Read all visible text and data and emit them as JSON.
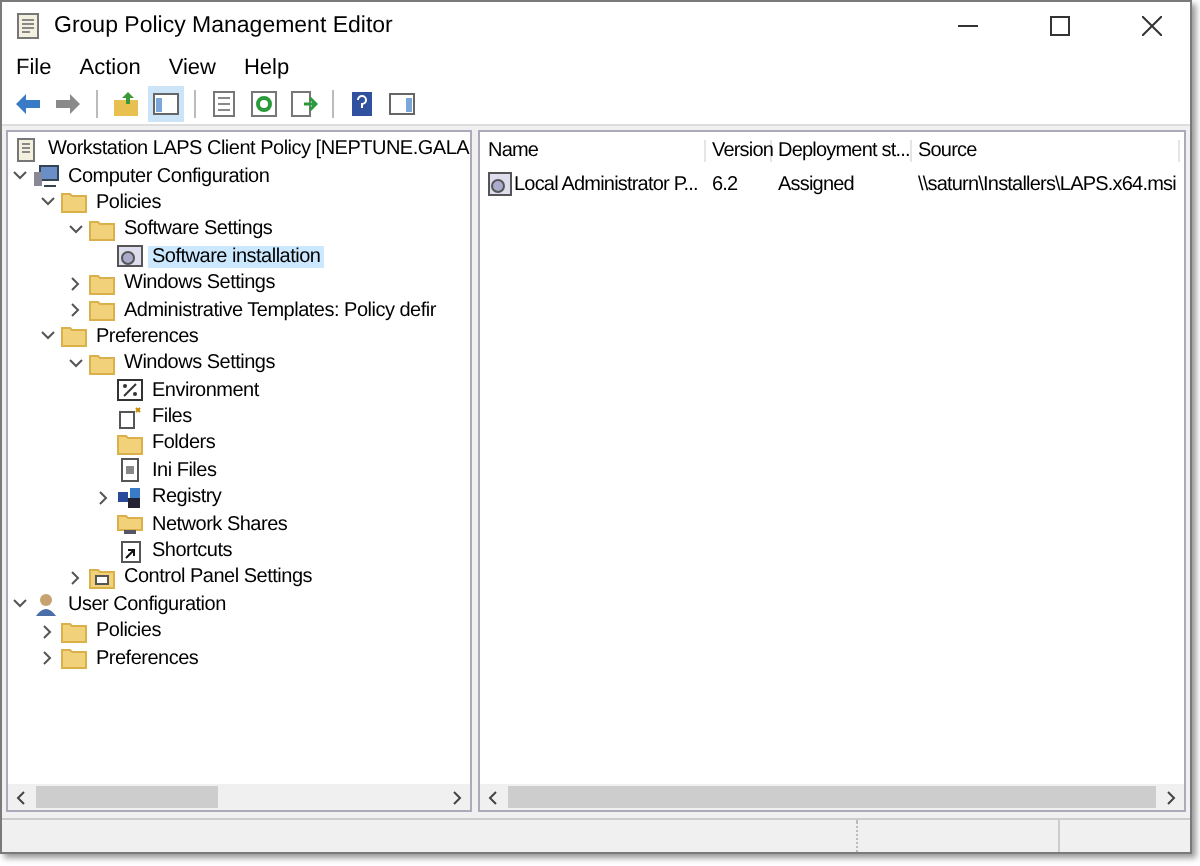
{
  "window": {
    "title": "Group Policy Management Editor"
  },
  "menu": [
    "File",
    "Action",
    "View",
    "Help"
  ],
  "toolbar": [
    {
      "kind": "back",
      "pressed": false
    },
    {
      "kind": "forward",
      "pressed": false
    },
    {
      "kind": "sep"
    },
    {
      "kind": "up",
      "pressed": false
    },
    {
      "kind": "tree",
      "pressed": true
    },
    {
      "kind": "sep"
    },
    {
      "kind": "properties",
      "pressed": false
    },
    {
      "kind": "refresh",
      "pressed": false
    },
    {
      "kind": "export",
      "pressed": false
    },
    {
      "kind": "sep"
    },
    {
      "kind": "help",
      "pressed": false
    },
    {
      "kind": "pane",
      "pressed": false
    }
  ],
  "tree": [
    {
      "label": "Workstation LAPS Client Policy [NEPTUNE.GALA",
      "kind": "policy",
      "selected": false
    },
    {
      "label": "Computer Configuration",
      "kind": "computer",
      "expanded": true,
      "selected": false,
      "children": [
        {
          "label": "Policies",
          "kind": "folder",
          "expanded": true,
          "selected": false,
          "children": [
            {
              "label": "Software Settings",
              "kind": "folder",
              "expanded": true,
              "selected": false,
              "children": [
                {
                  "label": "Software installation",
                  "kind": "install",
                  "selected": true
                }
              ]
            },
            {
              "label": "Windows Settings",
              "kind": "folder",
              "expanded": false,
              "selected": false
            },
            {
              "label": "Administrative Templates: Policy defir",
              "kind": "folder",
              "expanded": false,
              "selected": false
            }
          ]
        },
        {
          "label": "Preferences",
          "kind": "folder",
          "expanded": true,
          "selected": false,
          "children": [
            {
              "label": "Windows Settings",
              "kind": "folder",
              "expanded": true,
              "selected": false,
              "children": [
                {
                  "label": "Environment",
                  "kind": "env",
                  "selected": false
                },
                {
                  "label": "Files",
                  "kind": "files",
                  "selected": false
                },
                {
                  "label": "Folders",
                  "kind": "folder",
                  "selected": false
                },
                {
                  "label": "Ini Files",
                  "kind": "ini",
                  "selected": false
                },
                {
                  "label": "Registry",
                  "kind": "registry",
                  "expanded": false,
                  "selected": false
                },
                {
                  "label": "Network Shares",
                  "kind": "share",
                  "selected": false
                },
                {
                  "label": "Shortcuts",
                  "kind": "shortcut",
                  "selected": false
                }
              ]
            },
            {
              "label": "Control Panel Settings",
              "kind": "panel",
              "expanded": false,
              "selected": false
            }
          ]
        }
      ]
    },
    {
      "label": "User Configuration",
      "kind": "user",
      "expanded": true,
      "selected": false,
      "children": [
        {
          "label": "Policies",
          "kind": "folder",
          "expanded": false,
          "selected": false
        },
        {
          "label": "Preferences",
          "kind": "folder",
          "expanded": false,
          "selected": false
        }
      ]
    }
  ],
  "table": {
    "columns": [
      "Name",
      "Version",
      "Deployment st...",
      "Source"
    ],
    "rows": [
      [
        "Local Administrator P...",
        "6.2",
        "Assigned",
        "\\\\saturn\\Installers\\LAPS.x64.msi"
      ]
    ]
  }
}
